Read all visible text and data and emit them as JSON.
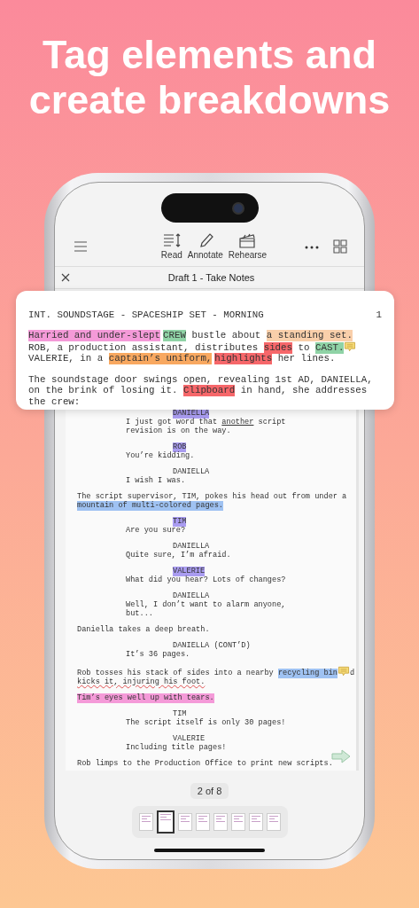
{
  "headline": "Tag elements and create breakdowns",
  "toolbar": {
    "buttons": [
      {
        "kind": "read",
        "label": "Read"
      },
      {
        "kind": "annotate",
        "label": "Annotate"
      },
      {
        "kind": "rehearse",
        "label": "Rehearse"
      }
    ]
  },
  "document_title": "Draft 1 - Take Notes",
  "card": {
    "heading": "INT. SOUNDSTAGE - SPACESHIP SET - MORNING",
    "page_number": "1",
    "paragraphs": [
      {
        "lines": [
          [
            {
              "kind": "text",
              "text": "Harried and under-slept",
              "color": "#f49ad8"
            },
            {
              "kind": "text",
              "text": "CREW",
              "color": "#8fd3a6",
              "space_before": true
            },
            {
              "kind": "text",
              "text": " bustle about "
            },
            {
              "kind": "text",
              "text": "a standing set.",
              "color": "#f9cfaa"
            }
          ],
          [
            {
              "kind": "text",
              "text": "ROB, a production assistant, distributes "
            },
            {
              "kind": "text",
              "text": "sides",
              "color": "#f6676a"
            },
            {
              "kind": "text",
              "text": " to "
            },
            {
              "kind": "text",
              "text": "CAST.",
              "color": "#8fd3a6"
            },
            {
              "kind": "note"
            }
          ],
          [
            {
              "kind": "text",
              "text": "VALERIE, in a "
            },
            {
              "kind": "text",
              "text": "captain’s uniform,",
              "color": "#f8a860"
            },
            {
              "kind": "text",
              "text": "highlights",
              "color": "#f6676a",
              "space_before": true
            },
            {
              "kind": "text",
              "text": " her lines."
            }
          ]
        ]
      },
      {
        "lines": [
          [
            {
              "kind": "text",
              "text": "The soundstage door swings open, revealing 1st AD, DANIELLA,"
            }
          ],
          [
            {
              "kind": "text",
              "text": "on the brink of losing it. "
            },
            {
              "kind": "text",
              "text": "Clipboard",
              "color": "#f6676a"
            },
            {
              "kind": "text",
              "text": " in hand, she addresses"
            }
          ],
          [
            {
              "kind": "text",
              "text": "the crew:"
            }
          ]
        ]
      }
    ]
  },
  "page_blocks": [
    {
      "kind": "character",
      "lines": [
        [
          {
            "kind": "text",
            "text": "DANIELLA",
            "color": "#a99cf0"
          }
        ]
      ]
    },
    {
      "kind": "dialogue",
      "lines": [
        [
          {
            "kind": "text",
            "text": "I just got word that "
          },
          {
            "kind": "text",
            "text": "another",
            "underlined": true
          },
          {
            "kind": "text",
            "text": " script"
          }
        ],
        [
          {
            "kind": "text",
            "text": "revision is on the way."
          }
        ]
      ]
    },
    {
      "kind": "character",
      "lines": [
        [
          {
            "kind": "text",
            "text": "ROB",
            "color": "#a99cf0"
          }
        ]
      ]
    },
    {
      "kind": "dialogue",
      "lines": [
        [
          {
            "kind": "text",
            "text": "You’re kidding."
          }
        ]
      ]
    },
    {
      "kind": "character",
      "lines": [
        [
          {
            "kind": "text",
            "text": "DANIELLA"
          }
        ]
      ]
    },
    {
      "kind": "dialogue",
      "lines": [
        [
          {
            "kind": "text",
            "text": "I wish I was."
          }
        ]
      ]
    },
    {
      "kind": "action",
      "lines": [
        [
          {
            "kind": "text",
            "text": "The script supervisor, TIM, pokes his head out from under a"
          }
        ],
        [
          {
            "kind": "text",
            "text": "mountain of multi-colored pages.",
            "color": "#9fc2f2"
          }
        ]
      ]
    },
    {
      "kind": "character",
      "lines": [
        [
          {
            "kind": "text",
            "text": "TIM",
            "color": "#a99cf0"
          }
        ]
      ]
    },
    {
      "kind": "dialogue",
      "lines": [
        [
          {
            "kind": "text",
            "text": "Are you sure?"
          }
        ]
      ]
    },
    {
      "kind": "character",
      "lines": [
        [
          {
            "kind": "text",
            "text": "DANIELLA"
          }
        ]
      ]
    },
    {
      "kind": "dialogue",
      "lines": [
        [
          {
            "kind": "text",
            "text": "Quite sure, I’m afraid."
          }
        ]
      ]
    },
    {
      "kind": "character",
      "lines": [
        [
          {
            "kind": "text",
            "text": "VALERIE",
            "color": "#a99cf0"
          }
        ]
      ]
    },
    {
      "kind": "dialogue",
      "lines": [
        [
          {
            "kind": "text",
            "text": "What did you hear? Lots of changes?"
          }
        ]
      ]
    },
    {
      "kind": "character",
      "lines": [
        [
          {
            "kind": "text",
            "text": "DANIELLA"
          }
        ]
      ]
    },
    {
      "kind": "dialogue",
      "lines": [
        [
          {
            "kind": "text",
            "text": "Well, I don’t want to alarm anyone,"
          }
        ],
        [
          {
            "kind": "text",
            "text": "but..."
          }
        ]
      ]
    },
    {
      "kind": "action",
      "lines": [
        [
          {
            "kind": "text",
            "text": "Daniella takes a deep breath."
          }
        ]
      ]
    },
    {
      "kind": "character",
      "lines": [
        [
          {
            "kind": "text",
            "text": "DANIELLA (CONT’D)"
          }
        ]
      ]
    },
    {
      "kind": "dialogue",
      "lines": [
        [
          {
            "kind": "text",
            "text": "It’s 36 pages."
          }
        ]
      ]
    },
    {
      "kind": "action",
      "lines": [
        [
          {
            "kind": "text",
            "text": "Rob tosses his stack of sides into a nearby "
          },
          {
            "kind": "text",
            "text": "recycling bin",
            "color": "#9fc2f2"
          },
          {
            "kind": "note"
          },
          {
            "kind": "text",
            "text": "d"
          }
        ],
        [
          {
            "kind": "text",
            "text": "kicks it, injuring his foot.",
            "misspelled": true
          }
        ]
      ]
    },
    {
      "kind": "action",
      "lines": [
        [
          {
            "kind": "text",
            "text": "Tim’s eyes well up with tears.",
            "color": "#f49ad8"
          }
        ]
      ]
    },
    {
      "kind": "character",
      "lines": [
        [
          {
            "kind": "text",
            "text": "TIM"
          }
        ]
      ]
    },
    {
      "kind": "dialogue",
      "lines": [
        [
          {
            "kind": "text",
            "text": "The script itself is only 30 pages!"
          }
        ]
      ]
    },
    {
      "kind": "character",
      "lines": [
        [
          {
            "kind": "text",
            "text": "VALERIE"
          }
        ]
      ]
    },
    {
      "kind": "dialogue",
      "lines": [
        [
          {
            "kind": "text",
            "text": "Including title pages!"
          }
        ]
      ]
    },
    {
      "kind": "action",
      "lines": [
        [
          {
            "kind": "text",
            "text": "Rob limps to the Production Office to print new scripts."
          }
        ]
      ]
    }
  ],
  "pager": "2 of 8",
  "thumbnails": [
    {
      "selected": false
    },
    {
      "selected": true
    },
    {
      "selected": false
    },
    {
      "selected": false
    },
    {
      "selected": false
    },
    {
      "selected": false
    },
    {
      "selected": false
    },
    {
      "selected": false
    }
  ]
}
